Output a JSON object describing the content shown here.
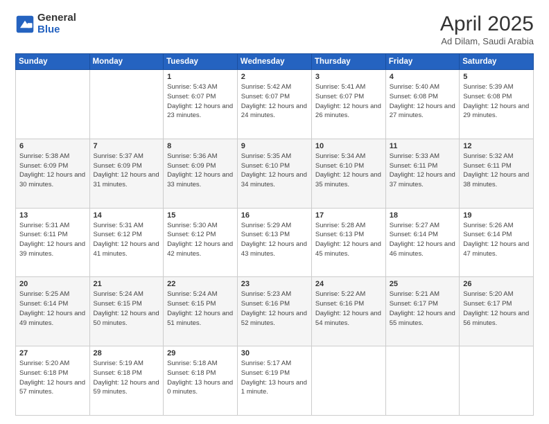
{
  "logo": {
    "general": "General",
    "blue": "Blue"
  },
  "header": {
    "title": "April 2025",
    "subtitle": "Ad Dilam, Saudi Arabia"
  },
  "weekdays": [
    "Sunday",
    "Monday",
    "Tuesday",
    "Wednesday",
    "Thursday",
    "Friday",
    "Saturday"
  ],
  "weeks": [
    [
      {
        "day": "",
        "info": ""
      },
      {
        "day": "",
        "info": ""
      },
      {
        "day": "1",
        "info": "Sunrise: 5:43 AM\nSunset: 6:07 PM\nDaylight: 12 hours and 23 minutes."
      },
      {
        "day": "2",
        "info": "Sunrise: 5:42 AM\nSunset: 6:07 PM\nDaylight: 12 hours and 24 minutes."
      },
      {
        "day": "3",
        "info": "Sunrise: 5:41 AM\nSunset: 6:07 PM\nDaylight: 12 hours and 26 minutes."
      },
      {
        "day": "4",
        "info": "Sunrise: 5:40 AM\nSunset: 6:08 PM\nDaylight: 12 hours and 27 minutes."
      },
      {
        "day": "5",
        "info": "Sunrise: 5:39 AM\nSunset: 6:08 PM\nDaylight: 12 hours and 29 minutes."
      }
    ],
    [
      {
        "day": "6",
        "info": "Sunrise: 5:38 AM\nSunset: 6:09 PM\nDaylight: 12 hours and 30 minutes."
      },
      {
        "day": "7",
        "info": "Sunrise: 5:37 AM\nSunset: 6:09 PM\nDaylight: 12 hours and 31 minutes."
      },
      {
        "day": "8",
        "info": "Sunrise: 5:36 AM\nSunset: 6:09 PM\nDaylight: 12 hours and 33 minutes."
      },
      {
        "day": "9",
        "info": "Sunrise: 5:35 AM\nSunset: 6:10 PM\nDaylight: 12 hours and 34 minutes."
      },
      {
        "day": "10",
        "info": "Sunrise: 5:34 AM\nSunset: 6:10 PM\nDaylight: 12 hours and 35 minutes."
      },
      {
        "day": "11",
        "info": "Sunrise: 5:33 AM\nSunset: 6:11 PM\nDaylight: 12 hours and 37 minutes."
      },
      {
        "day": "12",
        "info": "Sunrise: 5:32 AM\nSunset: 6:11 PM\nDaylight: 12 hours and 38 minutes."
      }
    ],
    [
      {
        "day": "13",
        "info": "Sunrise: 5:31 AM\nSunset: 6:11 PM\nDaylight: 12 hours and 39 minutes."
      },
      {
        "day": "14",
        "info": "Sunrise: 5:31 AM\nSunset: 6:12 PM\nDaylight: 12 hours and 41 minutes."
      },
      {
        "day": "15",
        "info": "Sunrise: 5:30 AM\nSunset: 6:12 PM\nDaylight: 12 hours and 42 minutes."
      },
      {
        "day": "16",
        "info": "Sunrise: 5:29 AM\nSunset: 6:13 PM\nDaylight: 12 hours and 43 minutes."
      },
      {
        "day": "17",
        "info": "Sunrise: 5:28 AM\nSunset: 6:13 PM\nDaylight: 12 hours and 45 minutes."
      },
      {
        "day": "18",
        "info": "Sunrise: 5:27 AM\nSunset: 6:14 PM\nDaylight: 12 hours and 46 minutes."
      },
      {
        "day": "19",
        "info": "Sunrise: 5:26 AM\nSunset: 6:14 PM\nDaylight: 12 hours and 47 minutes."
      }
    ],
    [
      {
        "day": "20",
        "info": "Sunrise: 5:25 AM\nSunset: 6:14 PM\nDaylight: 12 hours and 49 minutes."
      },
      {
        "day": "21",
        "info": "Sunrise: 5:24 AM\nSunset: 6:15 PM\nDaylight: 12 hours and 50 minutes."
      },
      {
        "day": "22",
        "info": "Sunrise: 5:24 AM\nSunset: 6:15 PM\nDaylight: 12 hours and 51 minutes."
      },
      {
        "day": "23",
        "info": "Sunrise: 5:23 AM\nSunset: 6:16 PM\nDaylight: 12 hours and 52 minutes."
      },
      {
        "day": "24",
        "info": "Sunrise: 5:22 AM\nSunset: 6:16 PM\nDaylight: 12 hours and 54 minutes."
      },
      {
        "day": "25",
        "info": "Sunrise: 5:21 AM\nSunset: 6:17 PM\nDaylight: 12 hours and 55 minutes."
      },
      {
        "day": "26",
        "info": "Sunrise: 5:20 AM\nSunset: 6:17 PM\nDaylight: 12 hours and 56 minutes."
      }
    ],
    [
      {
        "day": "27",
        "info": "Sunrise: 5:20 AM\nSunset: 6:18 PM\nDaylight: 12 hours and 57 minutes."
      },
      {
        "day": "28",
        "info": "Sunrise: 5:19 AM\nSunset: 6:18 PM\nDaylight: 12 hours and 59 minutes."
      },
      {
        "day": "29",
        "info": "Sunrise: 5:18 AM\nSunset: 6:18 PM\nDaylight: 13 hours and 0 minutes."
      },
      {
        "day": "30",
        "info": "Sunrise: 5:17 AM\nSunset: 6:19 PM\nDaylight: 13 hours and 1 minute."
      },
      {
        "day": "",
        "info": ""
      },
      {
        "day": "",
        "info": ""
      },
      {
        "day": "",
        "info": ""
      }
    ]
  ]
}
